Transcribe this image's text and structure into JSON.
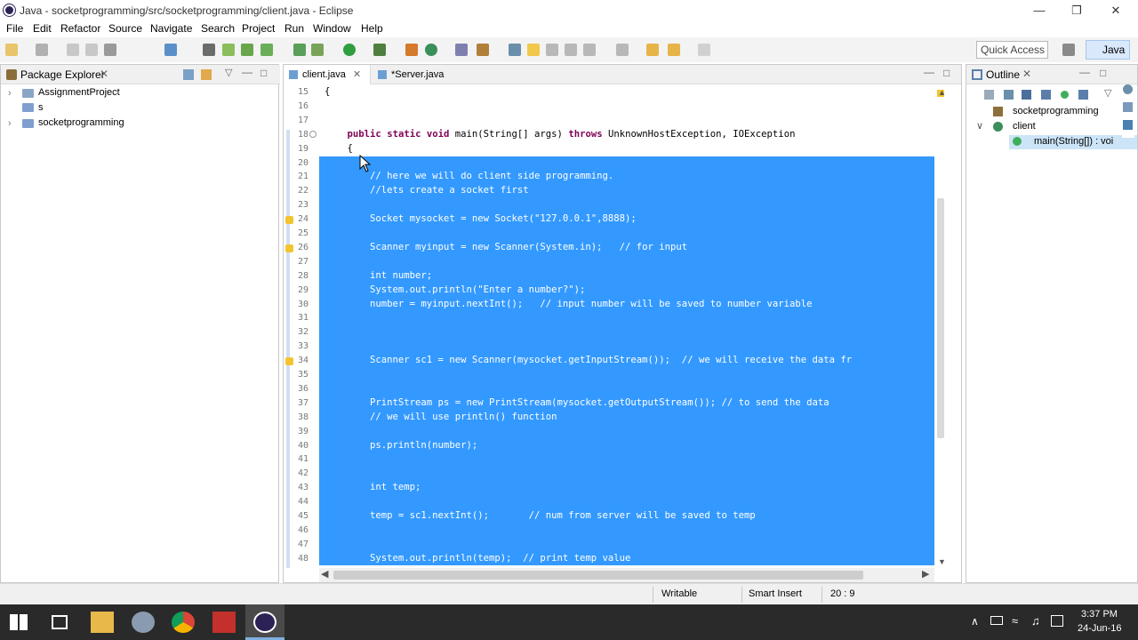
{
  "window": {
    "title": "Java - socketprogramming/src/socketprogramming/client.java - Eclipse"
  },
  "menu": [
    "File",
    "Edit",
    "Refactor",
    "Source",
    "Navigate",
    "Search",
    "Project",
    "Run",
    "Window",
    "Help"
  ],
  "quick_access": "Quick Access",
  "perspective": "Java",
  "package_explorer": {
    "title": "Package Explorer",
    "items": [
      "AssignmentProject",
      "s",
      "socketprogramming"
    ]
  },
  "editor": {
    "tabs": [
      "client.java",
      "*Server.java"
    ],
    "lines": [
      {
        "n": "15",
        "t": "{",
        "sel": false
      },
      {
        "n": "16",
        "t": "",
        "sel": false
      },
      {
        "n": "17",
        "t": "",
        "sel": false
      },
      {
        "n": "18",
        "t": "    public static void main(String[] args) throws UnknownHostException, IOException",
        "sel": false
      },
      {
        "n": "19",
        "t": "    {",
        "sel": false
      },
      {
        "n": "20",
        "t": "",
        "sel": true
      },
      {
        "n": "21",
        "t": "        // here we will do client side programming.",
        "sel": true
      },
      {
        "n": "22",
        "t": "        //lets create a socket first",
        "sel": true
      },
      {
        "n": "23",
        "t": "",
        "sel": true
      },
      {
        "n": "24",
        "t": "        Socket mysocket = new Socket(\"127.0.0.1\",8888);",
        "sel": true
      },
      {
        "n": "25",
        "t": "",
        "sel": true
      },
      {
        "n": "26",
        "t": "        Scanner myinput = new Scanner(System.in);   // for input",
        "sel": true
      },
      {
        "n": "27",
        "t": "",
        "sel": true
      },
      {
        "n": "28",
        "t": "        int number;",
        "sel": true
      },
      {
        "n": "29",
        "t": "        System.out.println(\"Enter a number?\");",
        "sel": true
      },
      {
        "n": "30",
        "t": "        number = myinput.nextInt();   // input number will be saved to number variable",
        "sel": true
      },
      {
        "n": "31",
        "t": "",
        "sel": true
      },
      {
        "n": "32",
        "t": "",
        "sel": true
      },
      {
        "n": "33",
        "t": "",
        "sel": true
      },
      {
        "n": "34",
        "t": "        Scanner sc1 = new Scanner(mysocket.getInputStream());  // we will receive the data fr",
        "sel": true
      },
      {
        "n": "35",
        "t": "",
        "sel": true
      },
      {
        "n": "36",
        "t": "",
        "sel": true
      },
      {
        "n": "37",
        "t": "        PrintStream ps = new PrintStream(mysocket.getOutputStream()); // to send the data",
        "sel": true
      },
      {
        "n": "38",
        "t": "        // we will use println() function",
        "sel": true
      },
      {
        "n": "39",
        "t": "",
        "sel": true
      },
      {
        "n": "40",
        "t": "        ps.println(number);",
        "sel": true
      },
      {
        "n": "41",
        "t": "",
        "sel": true
      },
      {
        "n": "42",
        "t": "",
        "sel": true
      },
      {
        "n": "43",
        "t": "        int temp;",
        "sel": true
      },
      {
        "n": "44",
        "t": "",
        "sel": true
      },
      {
        "n": "45",
        "t": "        temp = sc1.nextInt();       // num from server will be saved to temp",
        "sel": true
      },
      {
        "n": "46",
        "t": "",
        "sel": true
      },
      {
        "n": "47",
        "t": "",
        "sel": true
      },
      {
        "n": "48",
        "t": "        System.out.println(temp);  // print temp value",
        "sel": true
      }
    ]
  },
  "outline": {
    "title": "Outline",
    "items": [
      "socketprogramming",
      "client",
      "main(String[]) : voi"
    ]
  },
  "status": {
    "writable": "Writable",
    "insert": "Smart Insert",
    "position": "20 : 9"
  },
  "taskbar": {
    "time": "3:37 PM",
    "date": "24-Jun-16"
  }
}
